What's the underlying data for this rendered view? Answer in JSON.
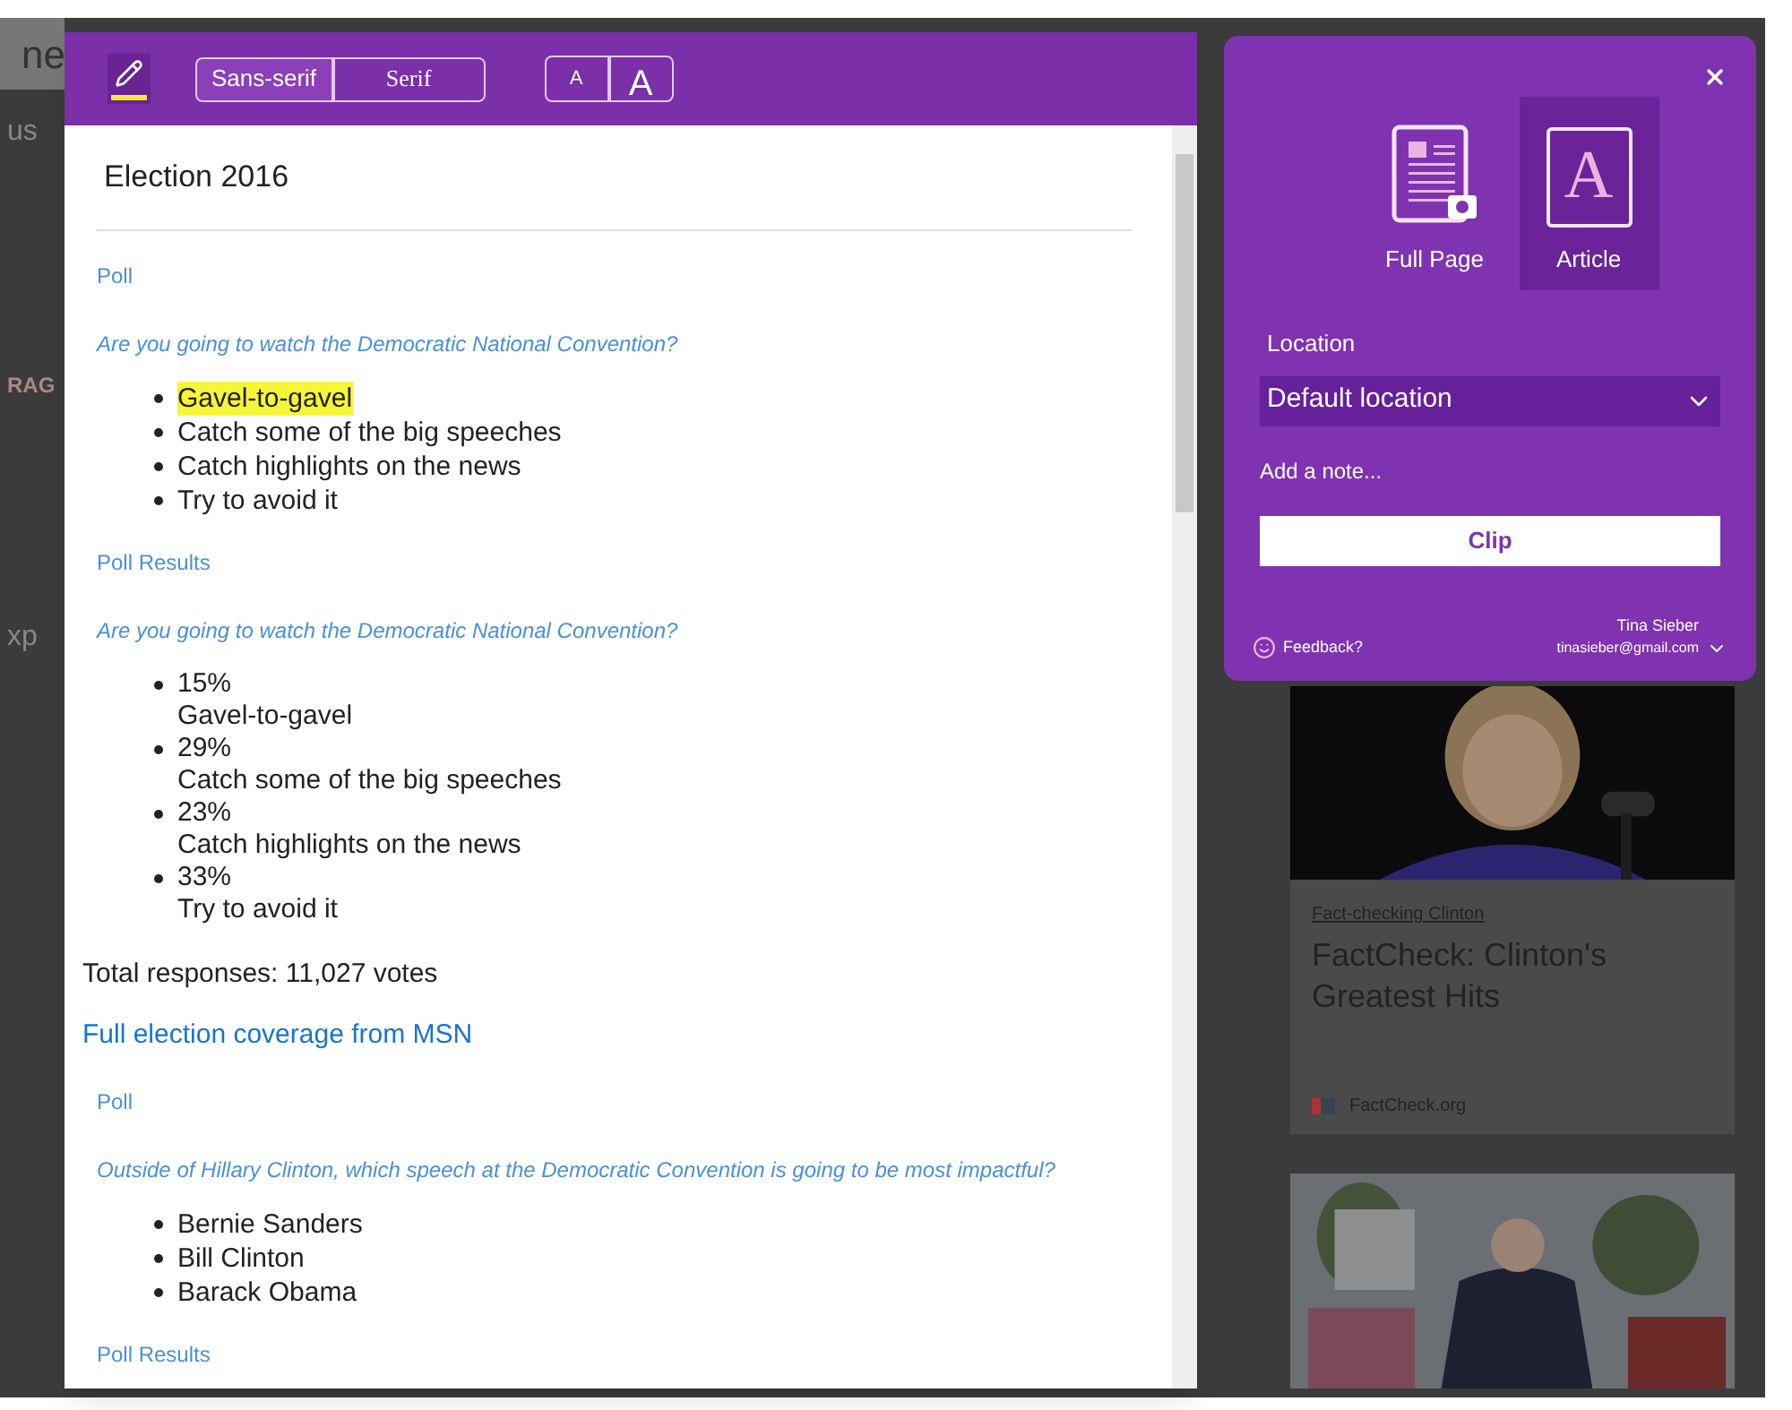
{
  "background": {
    "search_text": "ne",
    "fragments": [
      {
        "text": "us"
      },
      {
        "text": "RAG"
      },
      {
        "text": "xp"
      }
    ],
    "cards": [
      {
        "kind": "article",
        "tag": "Fact-checking Clinton",
        "headline": "FactCheck: Clinton's Greatest Hits",
        "source": "FactCheck.org"
      },
      {
        "kind": "picture"
      }
    ]
  },
  "reader": {
    "font_options": [
      {
        "label": "Sans-serif",
        "selected": true
      },
      {
        "label": "Serif",
        "selected": false
      }
    ],
    "size_buttons": [
      {
        "label": "A",
        "kind": "smaller"
      },
      {
        "label": "A",
        "kind": "larger"
      }
    ],
    "title": "Election 2016",
    "blocks": [
      {
        "kind": "label",
        "text": "Poll"
      },
      {
        "kind": "question",
        "text": "Are you going to watch the Democratic National Convention?"
      },
      {
        "kind": "options",
        "items": [
          {
            "text": "Gavel-to-gavel",
            "highlighted": true
          },
          {
            "text": "Catch some of the big speeches",
            "highlighted": false
          },
          {
            "text": "Catch highlights on the news",
            "highlighted": false
          },
          {
            "text": "Try to avoid it",
            "highlighted": false
          }
        ]
      },
      {
        "kind": "label",
        "text": "Poll Results"
      },
      {
        "kind": "question",
        "text": "Are you going to watch the Democratic National Convention?"
      },
      {
        "kind": "results",
        "items": [
          {
            "percent": "15%",
            "text": "Gavel-to-gavel"
          },
          {
            "percent": "29%",
            "text": "Catch some of the big speeches"
          },
          {
            "percent": "23%",
            "text": "Catch highlights on the news"
          },
          {
            "percent": "33%",
            "text": "Try to avoid it"
          }
        ]
      },
      {
        "kind": "text",
        "text": "Total responses: 11,027 votes"
      },
      {
        "kind": "link",
        "text": "Full election coverage from MSN"
      },
      {
        "kind": "label",
        "text": "Poll"
      },
      {
        "kind": "question",
        "text": "Outside of Hillary Clinton, which speech at the Democratic Convention is going to be most impactful?"
      },
      {
        "kind": "options",
        "items": [
          {
            "text": "Bernie Sanders",
            "highlighted": false
          },
          {
            "text": "Bill Clinton",
            "highlighted": false
          },
          {
            "text": "Barack Obama",
            "highlighted": false
          }
        ]
      },
      {
        "kind": "label",
        "text": "Poll Results"
      }
    ]
  },
  "clipper": {
    "modes": [
      {
        "label": "Full Page",
        "kind": "page",
        "selected": false
      },
      {
        "label": "Article",
        "kind": "article",
        "glyph": "A",
        "selected": true
      }
    ],
    "location_label": "Location",
    "location_value": "Default location",
    "note_placeholder": "Add a note...",
    "clip_button": "Clip",
    "feedback": "Feedback?",
    "user_name": "Tina Sieber",
    "user_email": "tinasieber@gmail.com"
  }
}
